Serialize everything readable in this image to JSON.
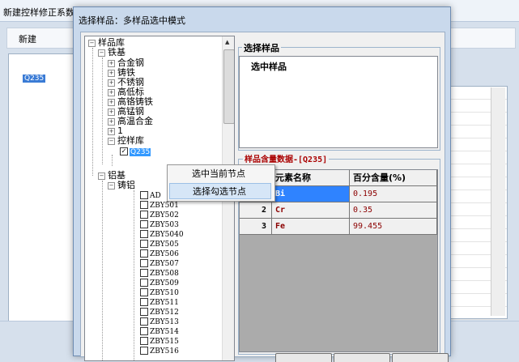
{
  "background": {
    "window_title": "新建控样修正系数",
    "new_button": "新建",
    "tree_node": "Q235"
  },
  "dialog": {
    "title": "选择样品：多样品选中模式",
    "tree": {
      "root": "样品库",
      "iron_base": "铁基",
      "iron_children": [
        "合金钢",
        "铸铁",
        "不锈钢",
        "高低标",
        "高铬铸铁",
        "高锰钢",
        "高温合金",
        "1",
        "控样库"
      ],
      "selected_leaf": "Q235",
      "aluminum_base": "铝基",
      "cast_aluminum": "铸铝",
      "aluminum_leaves": [
        "AD",
        "ZBY501",
        "ZBY502",
        "ZBY503",
        "ZBY5040",
        "ZBY505",
        "ZBY506",
        "ZBY507",
        "ZBY508",
        "ZBY509",
        "ZBY510",
        "ZBY511",
        "ZBY512",
        "ZBY513",
        "ZBY514",
        "ZBY515",
        "ZBY516"
      ]
    },
    "context_menu": {
      "item1": "选中当前节点",
      "item2": "选择勾选节点"
    },
    "selected_samples": {
      "group_title": "选择样品",
      "child_label": "选中样品"
    },
    "content_data": {
      "title_partial": "样品含量数据-[Q235]",
      "headers": [
        "元素名称",
        "百分含量(%)"
      ],
      "rows": [
        {
          "index": "",
          "element": "Bi",
          "percent": "0.195"
        },
        {
          "index": "2",
          "element": "Cr",
          "percent": "0.35"
        },
        {
          "index": "3",
          "element": "Fe",
          "percent": "99.455"
        }
      ]
    }
  }
}
